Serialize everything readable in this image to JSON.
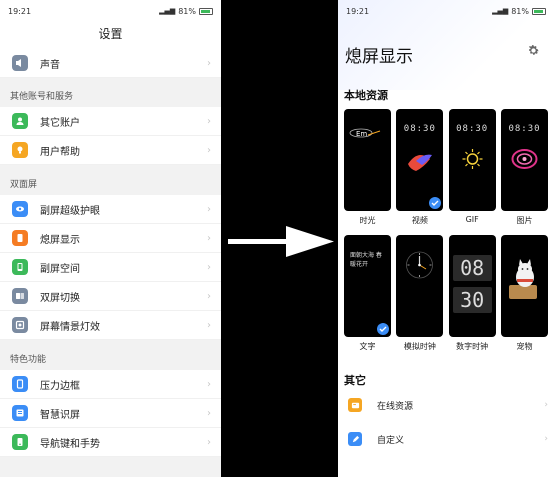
{
  "left": {
    "status": {
      "time": "19:21",
      "battery": "81%"
    },
    "title": "设置",
    "top_row": {
      "label": "声音"
    },
    "sections": [
      {
        "title": "其他账号和服务",
        "items": [
          "其它账户",
          "用户帮助"
        ]
      },
      {
        "title": "双面屏",
        "items": [
          "副屏超级护眼",
          "熄屏显示",
          "副屏空间",
          "双屏切换",
          "屏幕情景灯效"
        ]
      },
      {
        "title": "特色功能",
        "items": [
          "压力边框",
          "智慧识屏",
          "导航键和手势"
        ]
      }
    ]
  },
  "right": {
    "status": {
      "time": "19:21",
      "battery": "81%"
    },
    "title": "熄屏显示",
    "local_title": "本地资源",
    "cards": [
      {
        "label": "时光",
        "selected": false
      },
      {
        "label": "视频",
        "selected": true,
        "clock": "08:30"
      },
      {
        "label": "GIF",
        "selected": false,
        "clock": "08:30"
      },
      {
        "label": "图片",
        "selected": false,
        "clock": "08:30"
      },
      {
        "label": "文字",
        "selected": true,
        "text": "面朝大海 春暖花开"
      },
      {
        "label": "模拟时钟",
        "selected": false
      },
      {
        "label": "数字时钟",
        "selected": false,
        "digits": [
          "08",
          "30"
        ]
      },
      {
        "label": "宠物",
        "selected": false
      }
    ],
    "other_title": "其它",
    "other_items": [
      {
        "label": "在线资源",
        "icon": "online-resource-icon",
        "color": "#f5a623"
      },
      {
        "label": "自定义",
        "icon": "pencil-icon",
        "color": "#3b8df6"
      }
    ]
  },
  "colors": {
    "accent": "#3b8df6",
    "check": "#3b8df6"
  }
}
